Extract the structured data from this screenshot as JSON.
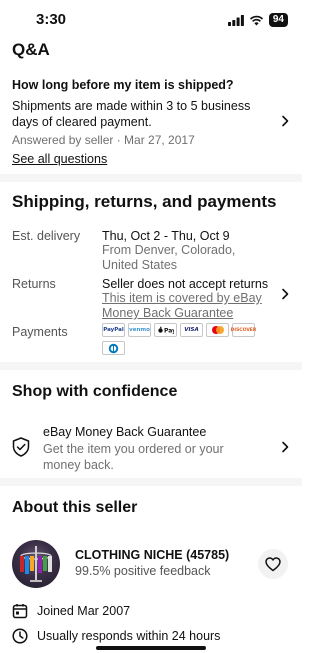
{
  "status": {
    "time": "3:30",
    "battery": "94"
  },
  "qa": {
    "title": "Q&A",
    "question": "How long before my item is shipped?",
    "answer": "Shipments are made within 3 to 5 business days of cleared payment.",
    "answered_by": "Answered by seller · Mar 27, 2017",
    "see_all": "See all questions"
  },
  "shipping": {
    "title": "Shipping, returns, and payments",
    "delivery_label": "Est. delivery",
    "delivery_dates": "Thu, Oct 2 - Thu, Oct 9",
    "delivery_from": "From Denver, Colorado, United States",
    "returns_label": "Returns",
    "returns_value": "Seller does not accept returns",
    "returns_link": "This item is covered by eBay Money Back Guarantee",
    "payments_label": "Payments",
    "payment_methods": [
      "PayPal",
      "Venmo",
      "Apple Pay",
      "Visa",
      "Mastercard",
      "Discover",
      "Diners Club"
    ]
  },
  "confidence": {
    "title": "Shop with confidence",
    "item_title": "eBay Money Back Guarantee",
    "item_sub": "Get the item you ordered or your money back."
  },
  "seller": {
    "title": "About this seller",
    "name": "CLOTHING NICHE (45785)",
    "feedback": "99.5% positive feedback",
    "joined": "Joined Mar 2007",
    "responds": "Usually responds within 24 hours"
  },
  "colors": {
    "accent": "#111111",
    "muted": "#707070",
    "divider": "#f5f5f5"
  }
}
